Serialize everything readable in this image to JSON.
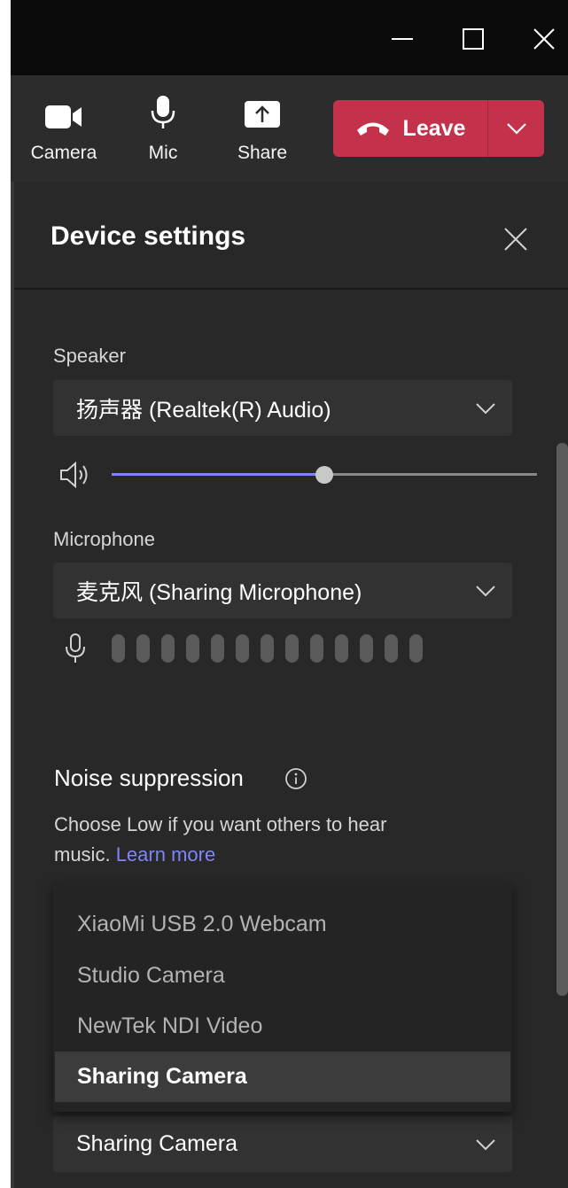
{
  "window": {
    "minimize_icon": "minimize-icon",
    "maximize_icon": "maximize-icon",
    "close_icon": "close-icon"
  },
  "toolbar": {
    "camera_label": "Camera",
    "mic_label": "Mic",
    "share_label": "Share",
    "leave_label": "Leave"
  },
  "panel": {
    "title": "Device settings",
    "speaker_label": "Speaker",
    "speaker_value": "扬声器 (Realtek(R) Audio)",
    "speaker_volume_fraction": 0.5,
    "microphone_label": "Microphone",
    "microphone_value": "麦克风 (Sharing Microphone)",
    "mic_level_bars": 13,
    "noise_title": "Noise suppression",
    "noise_desc": "Choose Low if you want others to hear music.",
    "learn_more": "Learn more"
  },
  "camera_dropdown": {
    "options": [
      "XiaoMi USB 2.0 Webcam",
      "Studio Camera",
      "NewTek NDI Video",
      "Sharing Camera"
    ],
    "highlighted_index": 3,
    "selected_value": "Sharing Camera"
  },
  "colors": {
    "leave_red": "#c4314b",
    "accent_purple": "#7f85f5",
    "panel_bg": "#292828"
  }
}
